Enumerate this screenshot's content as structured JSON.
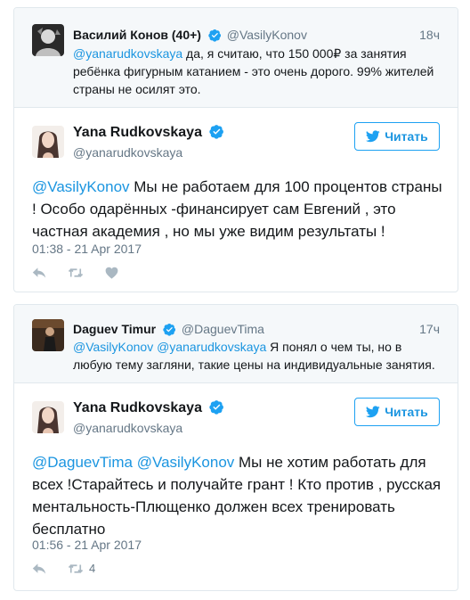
{
  "colors": {
    "accent": "#1da1f2",
    "link": "#1b95e0",
    "muted": "#657786",
    "icon": "#aab8c2",
    "verified": "#1da1f2"
  },
  "threads": [
    {
      "parent": {
        "name": "Василий Конов (40+)",
        "handle": "@VasilyKonov",
        "time": "18ч",
        "mentions": [
          "@yanarudkovskaya"
        ],
        "text": " да, я считаю, что 150 000₽ за занятия ребёнка фигурным катанием - это очень дорого. 99% жителей страны не осилят это."
      },
      "reply": {
        "name": "Yana Rudkovskaya",
        "handle": "@yanarudkovskaya",
        "follow_label": "Читать",
        "mentions": [
          "@VasilyKonov"
        ],
        "text": " Мы не работаем для 100 процентов страны ! Особо одарённых -финансирует сам Евгений , это частная академия , но мы уже видим результаты !",
        "datetime": "01:38 - 21 Apr 2017",
        "retweet_count": ""
      }
    },
    {
      "parent": {
        "name": "Daguev Timur",
        "handle": "@DaguevTima",
        "time": "17ч",
        "mentions": [
          "@VasilyKonov",
          "@yanarudkovskaya"
        ],
        "text": " Я понял о чем ты, но в любую тему загляни, такие цены на индивидуальные занятия."
      },
      "reply": {
        "name": "Yana Rudkovskaya",
        "handle": "@yanarudkovskaya",
        "follow_label": "Читать",
        "mentions": [
          "@DaguevTima",
          "@VasilyKonov"
        ],
        "text": " Мы не хотим работать для всех !Старайтесь и получайте грант ! Кто против , русская ментальность-Плющенко должен всех тренировать бесплатно",
        "datetime": "01:56 - 21 Apr 2017",
        "retweet_count": "4"
      }
    }
  ]
}
